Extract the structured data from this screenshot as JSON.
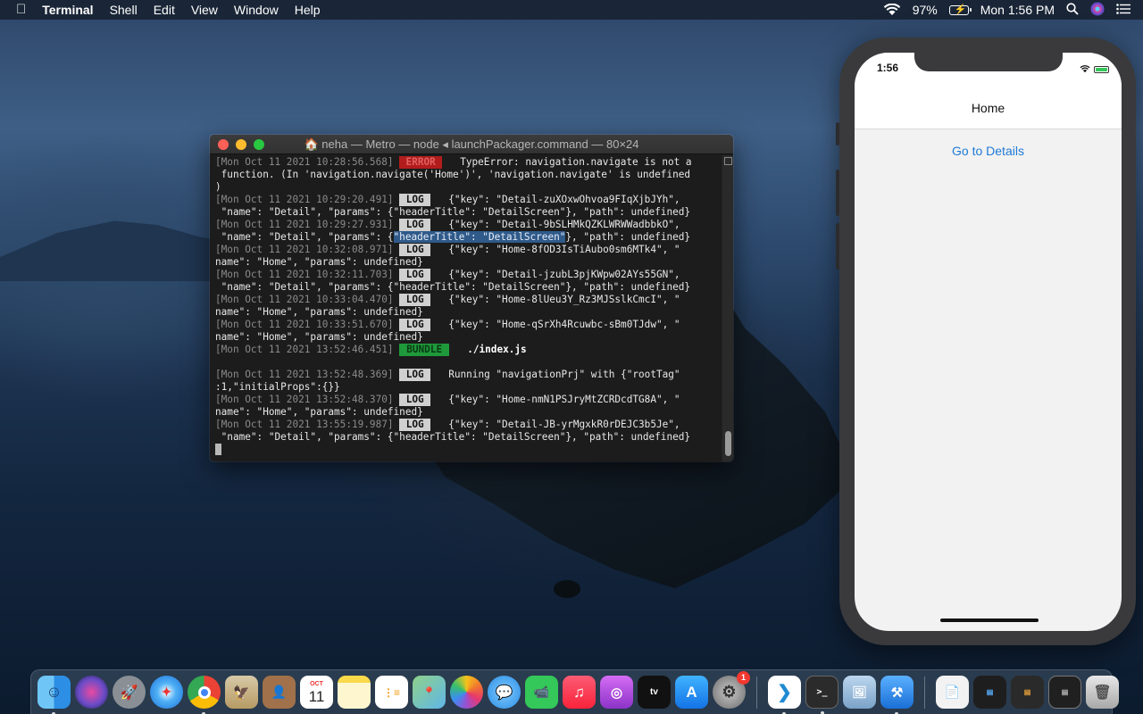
{
  "menubar": {
    "app_name": "Terminal",
    "menus": [
      "Shell",
      "Edit",
      "View",
      "Window",
      "Help"
    ],
    "battery_percent": "97%",
    "clock": "Mon 1:56 PM"
  },
  "terminal": {
    "title": "neha — Metro — node ◂ launchPackager.command — 80×24",
    "lines": [
      {
        "ts": "[Mon Oct 11 2021 10:28:56.568]",
        "tag": "ERROR",
        "text": "TypeError: navigation.navigate is not a"
      },
      {
        "text": " function. (In 'navigation.navigate('Home')', 'navigation.navigate' is undefined"
      },
      {
        "text": ")"
      },
      {
        "ts": "[Mon Oct 11 2021 10:29:20.491]",
        "tag": "LOG",
        "text": "{\"key\": \"Detail-zuXOxwOhvoa9FIqXjbJYh\","
      },
      {
        "text": " \"name\": \"Detail\", \"params\": {\"headerTitle\": \"DetailScreen\"}, \"path\": undefined}"
      },
      {
        "ts": "[Mon Oct 11 2021 10:29:27.931]",
        "tag": "LOG",
        "text": "{\"key\": \"Detail-9bSLHMkQZKLWRWWadbbkO\","
      },
      {
        "pre": " \"name\": \"Detail\", \"params\": {",
        "hl": "\"headerTitle\": \"DetailScreen\"",
        "post": "}, \"path\": undefined}"
      },
      {
        "ts": "[Mon Oct 11 2021 10:32:08.971]",
        "tag": "LOG",
        "text": "{\"key\": \"Home-8fOD3IsTiAubo0sm6MTk4\", \""
      },
      {
        "text": "name\": \"Home\", \"params\": undefined}"
      },
      {
        "ts": "[Mon Oct 11 2021 10:32:11.703]",
        "tag": "LOG",
        "text": "{\"key\": \"Detail-jzubL3pjKWpw02AYs55GN\","
      },
      {
        "text": " \"name\": \"Detail\", \"params\": {\"headerTitle\": \"DetailScreen\"}, \"path\": undefined}"
      },
      {
        "ts": "[Mon Oct 11 2021 10:33:04.470]",
        "tag": "LOG",
        "text": "{\"key\": \"Home-8lUeu3Y_Rz3MJSslkCmcI\", \""
      },
      {
        "text": "name\": \"Home\", \"params\": undefined}"
      },
      {
        "ts": "[Mon Oct 11 2021 10:33:51.670]",
        "tag": "LOG",
        "text": "{\"key\": \"Home-qSrXh4Rcuwbc-sBm0TJdw\", \""
      },
      {
        "text": "name\": \"Home\", \"params\": undefined}"
      },
      {
        "ts": "[Mon Oct 11 2021 13:52:46.451]",
        "tag": "BUNDLE",
        "bold_text": "./index.js"
      },
      {
        "text": ""
      },
      {
        "ts": "[Mon Oct 11 2021 13:52:48.369]",
        "tag": "LOG",
        "text": "Running \"navigationPrj\" with {\"rootTag\""
      },
      {
        "text": ":1,\"initialProps\":{}}"
      },
      {
        "ts": "[Mon Oct 11 2021 13:52:48.370]",
        "tag": "LOG",
        "text": "{\"key\": \"Home-nmN1PSJryMtZCRDcdTG8A\", \""
      },
      {
        "text": "name\": \"Home\", \"params\": undefined}"
      },
      {
        "ts": "[Mon Oct 11 2021 13:55:19.987]",
        "tag": "LOG",
        "text": "{\"key\": \"Detail-JB-yrMgxkR0rDEJC3b5Je\","
      },
      {
        "text": " \"name\": \"Detail\", \"params\": {\"headerTitle\": \"DetailScreen\"}, \"path\": undefined}"
      }
    ]
  },
  "simulator": {
    "time": "1:56",
    "nav_title": "Home",
    "link_label": "Go to Details"
  },
  "dock": {
    "calendar_month": "OCT",
    "calendar_day": "11",
    "sysprefs_badge": "1",
    "icons": [
      "finder-icon",
      "siri-icon",
      "launchpad-icon",
      "safari-icon",
      "chrome-icon",
      "mail-icon",
      "contacts-icon",
      "calendar-icon",
      "notes-icon",
      "reminders-icon",
      "maps-icon",
      "photos-icon",
      "messages-icon",
      "facetime-icon",
      "music-icon",
      "podcasts-icon",
      "tv-icon",
      "app-store-icon",
      "system-preferences-icon",
      "vscode-icon",
      "terminal-icon",
      "preview-icon",
      "xcode-icon",
      "document-icon",
      "window-thumbnail-1-icon",
      "window-thumbnail-2-icon",
      "window-thumbnail-3-icon",
      "trash-icon"
    ]
  }
}
